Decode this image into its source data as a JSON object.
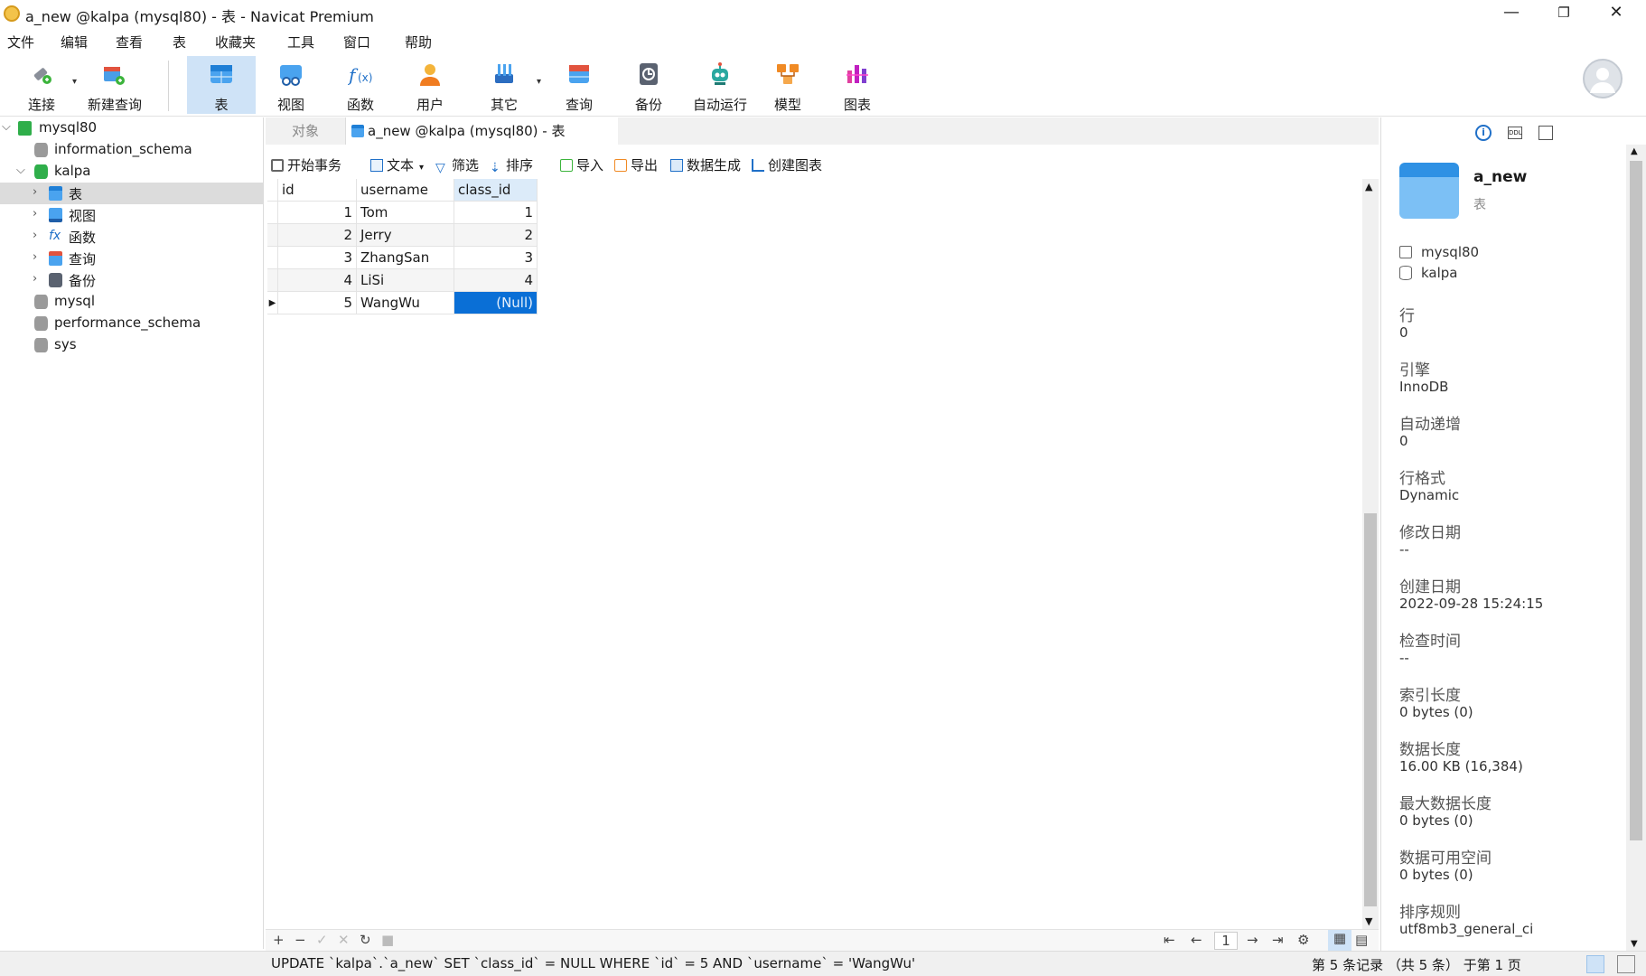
{
  "window": {
    "title": "a_new @kalpa (mysql80) - 表 - Navicat Premium"
  },
  "menu": [
    "文件",
    "编辑",
    "查看",
    "表",
    "收藏夹",
    "工具",
    "窗口",
    "帮助"
  ],
  "toolbar": {
    "connect": "连接",
    "new_query": "新建查询",
    "table": "表",
    "view": "视图",
    "function": "函数",
    "user": "用户",
    "other": "其它",
    "query": "查询",
    "backup": "备份",
    "auto_run": "自动运行",
    "model": "模型",
    "chart": "图表"
  },
  "tree": {
    "connection": "mysql80",
    "dbs": [
      "information_schema",
      "kalpa",
      "mysql",
      "performance_schema",
      "sys"
    ],
    "kalpa_children": [
      "表",
      "视图",
      "函数",
      "查询",
      "备份"
    ]
  },
  "tabs": {
    "objects": "对象",
    "active": "a_new @kalpa (mysql80) - 表"
  },
  "datatools": {
    "begin_tx": "开始事务",
    "text": "文本",
    "filter": "筛选",
    "sort": "排序",
    "import": "导入",
    "export": "导出",
    "data_gen": "数据生成",
    "create_chart": "创建图表"
  },
  "grid": {
    "columns": [
      "id",
      "username",
      "class_id"
    ],
    "rows": [
      [
        "1",
        "Tom",
        "1"
      ],
      [
        "2",
        "Jerry",
        "2"
      ],
      [
        "3",
        "ZhangSan",
        "3"
      ],
      [
        "4",
        "LiSi",
        "4"
      ],
      [
        "5",
        "WangWu",
        "(Null)"
      ]
    ]
  },
  "pager": {
    "page": "1"
  },
  "status": {
    "sql": "UPDATE `kalpa`.`a_new` SET `class_id` = NULL WHERE `id` = 5 AND `username` = 'WangWu'",
    "records": "第 5 条记录 （共 5 条） 于第 1 页"
  },
  "info": {
    "name": "a_new",
    "type": "表",
    "connection": "mysql80",
    "database": "kalpa",
    "props": [
      {
        "label": "行",
        "value": "0"
      },
      {
        "label": "引擎",
        "value": "InnoDB"
      },
      {
        "label": "自动递增",
        "value": "0"
      },
      {
        "label": "行格式",
        "value": "Dynamic"
      },
      {
        "label": "修改日期",
        "value": "--"
      },
      {
        "label": "创建日期",
        "value": "2022-09-28 15:24:15"
      },
      {
        "label": "检查时间",
        "value": "--"
      },
      {
        "label": "索引长度",
        "value": "0 bytes (0)"
      },
      {
        "label": "数据长度",
        "value": "16.00 KB (16,384)"
      },
      {
        "label": "最大数据长度",
        "value": "0 bytes (0)"
      },
      {
        "label": "数据可用空间",
        "value": "0 bytes (0)"
      },
      {
        "label": "排序规则",
        "value": "utf8mb3_general_ci"
      }
    ]
  },
  "colors": {
    "accent": "#0a6fd6",
    "selected_tool": "#cfe3f7"
  }
}
